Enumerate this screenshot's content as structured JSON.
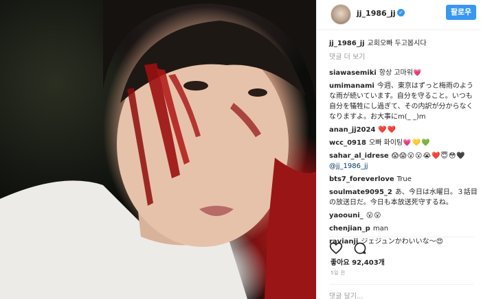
{
  "post": {
    "username": "jj_1986_jj",
    "follow_label": "팔로우",
    "caption_user": "jj_1986_jj",
    "caption_text": "교회오빠 두고봅시다",
    "load_more": "댓글 더 보기",
    "likes": "좋아요 92,403개",
    "time": "5일 전",
    "add_comment_placeholder": "댓글 달기..."
  },
  "comments": [
    {
      "user": "siawasemiki",
      "text": "항상 고마워",
      "emoji": "💗"
    },
    {
      "user": "umimanami",
      "text": "今週、東京はずっと梅雨のような雨が続いています。自分を守ること。いつも自分を犠牲にし過ぎて、その内訳が分からなくなりますよ。お大事にm(_ _)m",
      "emoji": ""
    },
    {
      "user": "anan_jj2024",
      "text": "",
      "emoji": "❤️❤️"
    },
    {
      "user": "wcc_0918",
      "text": "오빠 화이팅",
      "emoji": "💗💛💚"
    },
    {
      "user": "sahar_al_idrese",
      "text": "",
      "emoji": "😱😱😮😮😭❤️😇😳🖤"
    },
    {
      "user": "bts7_foreverlove",
      "text": "True",
      "emoji": ""
    },
    {
      "user": "soulmate9095_2",
      "text": "あ、今日は水曜日。３話目の放送日だ。今日も本放送死守するね。",
      "emoji": ""
    },
    {
      "user": "yaoouni_",
      "text": "",
      "emoji": "😮😮"
    },
    {
      "user": "chenjian_p",
      "text": "man",
      "emoji": ""
    },
    {
      "user": "ravianji",
      "text": "ジェジュンかわいいな〜",
      "emoji": "😍"
    }
  ],
  "mention": "@jj_1986_jj",
  "icons": {
    "verified": "verified-badge-icon",
    "like": "heart-icon",
    "comment": "comment-bubble-icon"
  },
  "colors": {
    "accent": "#3897f0",
    "text": "#262626",
    "muted": "#999999",
    "mention": "#003569"
  }
}
